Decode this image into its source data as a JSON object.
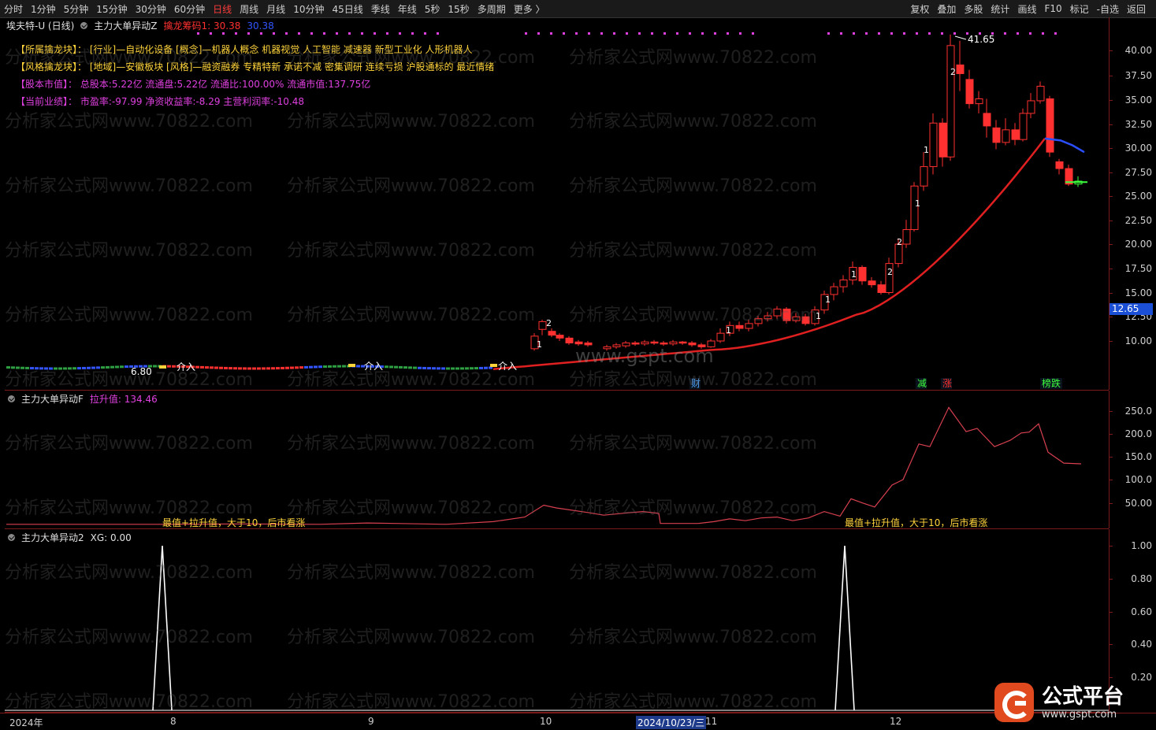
{
  "toolbar": {
    "timeframes": [
      "分时",
      "1分钟",
      "5分钟",
      "15分钟",
      "30分钟",
      "60分钟",
      "日线",
      "周线",
      "月线",
      "10分钟",
      "45日线",
      "季线",
      "年线",
      "5秒",
      "15秒",
      "多周期",
      "更多 〉"
    ],
    "active": "日线",
    "tools": [
      "复权",
      "叠加",
      "多股",
      "统计",
      "画线",
      "F10",
      "标记",
      "-自选",
      "返回"
    ]
  },
  "pane1": {
    "stock_title": "埃夫特-U (日线)",
    "indicator_name": "主力大单异动Z",
    "indicator_label": "擒龙筹码1: 30.38",
    "indicator_value2": "30.38",
    "info": [
      {
        "label": "【所属擒龙块】：",
        "text": "[行业]—自动化设备 [概念]—机器人概念 机器视觉 人工智能 减速器 新型工业化 人形机器人"
      },
      {
        "label": "【风格擒龙块】：",
        "text": "[地域]—安徽板块 [风格]—融资融券 专精特新 承诺不减 密集调研 连续亏损 沪股通标的 最近情绪"
      },
      {
        "label": "【股本市值】：",
        "text": "总股本:5.22亿 流通盘:5.22亿 流通比:100.00% 流通市值:137.75亿"
      },
      {
        "label": "【当前业绩】：",
        "text": "市盈率:-97.99 净资收益率:-8.29 主营利润率:-10.48"
      }
    ],
    "high_label": "41.65",
    "low_label": "6.80",
    "current_price": "12.65",
    "entry_label": "介入",
    "bottom_marks": [
      "财",
      "减",
      "涨",
      "榜跌"
    ],
    "candle_marks": [
      "2",
      "1",
      "1",
      "1",
      "1",
      "2",
      "1",
      "1",
      "2",
      "1",
      "2",
      "1"
    ],
    "axis": [
      "40.00",
      "37.50",
      "35.00",
      "32.50",
      "30.00",
      "27.50",
      "25.00",
      "22.50",
      "20.00",
      "17.50",
      "15.00",
      "12.50",
      "10.00"
    ]
  },
  "pane2": {
    "indicator_name": "主力大单异动F",
    "value_label": "拉升值: 134.46",
    "note": "最值+拉升值，大于10，后市看涨",
    "axis": [
      "250.0",
      "200.0",
      "150.0",
      "100.0",
      "50.00"
    ]
  },
  "pane3": {
    "indicator_name": "主力大单异动2",
    "value_label": "XG: 0.00",
    "axis": [
      "1.00",
      "0.80",
      "0.60",
      "0.40",
      "0.20"
    ]
  },
  "time_axis": {
    "labels": [
      "2024年",
      "8",
      "9",
      "10",
      "2024/10/23/三",
      "11",
      "12"
    ]
  },
  "watermark": {
    "text": "分析家公式网www.70822.com",
    "center": "www.gspt.com"
  },
  "logo": {
    "main": "公式平台",
    "sub": "www.gspt.com"
  },
  "chart_data": {
    "type": "line",
    "price_series": {
      "name": "擒龙筹码1",
      "x": [
        "2024-07",
        "2024-08",
        "2024-09",
        "2024-10",
        "2024-11",
        "2024-12"
      ],
      "values": [
        7.0,
        7.0,
        7.0,
        8.5,
        11.5,
        30.38
      ]
    },
    "lift_series": {
      "name": "拉升值",
      "approx_peak": 258,
      "last": 134.46
    },
    "xg_series": {
      "name": "XG",
      "signals": 2,
      "peak": 1.0
    },
    "price_range": [
      6.8,
      41.65
    ],
    "lift_range": [
      0,
      260
    ],
    "xg_range": [
      0,
      1
    ]
  }
}
